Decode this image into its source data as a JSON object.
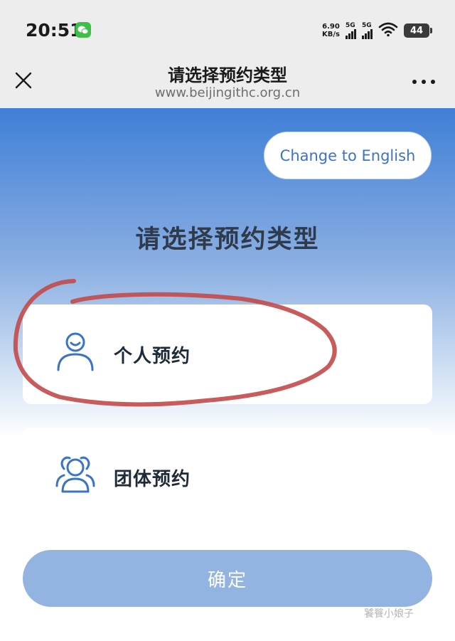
{
  "status_bar": {
    "time": "20:51",
    "net_speed_value": "6.90",
    "net_speed_unit": "KB/s",
    "signal_1_label": "5G",
    "signal_2_label": "5G",
    "battery": "44"
  },
  "nav": {
    "title": "请选择预约类型",
    "url": "www.beijingithc.org.cn"
  },
  "page": {
    "language_button": "Change to English",
    "heading": "请选择预约类型",
    "options": [
      {
        "label": "个人预约",
        "icon": "person-icon"
      },
      {
        "label": "团体预约",
        "icon": "group-icon"
      }
    ],
    "confirm_button": "确定",
    "watermark": "饕餮小娘子"
  },
  "colors": {
    "accent": "#3a74c7",
    "header_gradient_top": "#3f7fd6",
    "confirm_disabled": "#93b3e0",
    "annotation_red": "#c24a4a"
  }
}
